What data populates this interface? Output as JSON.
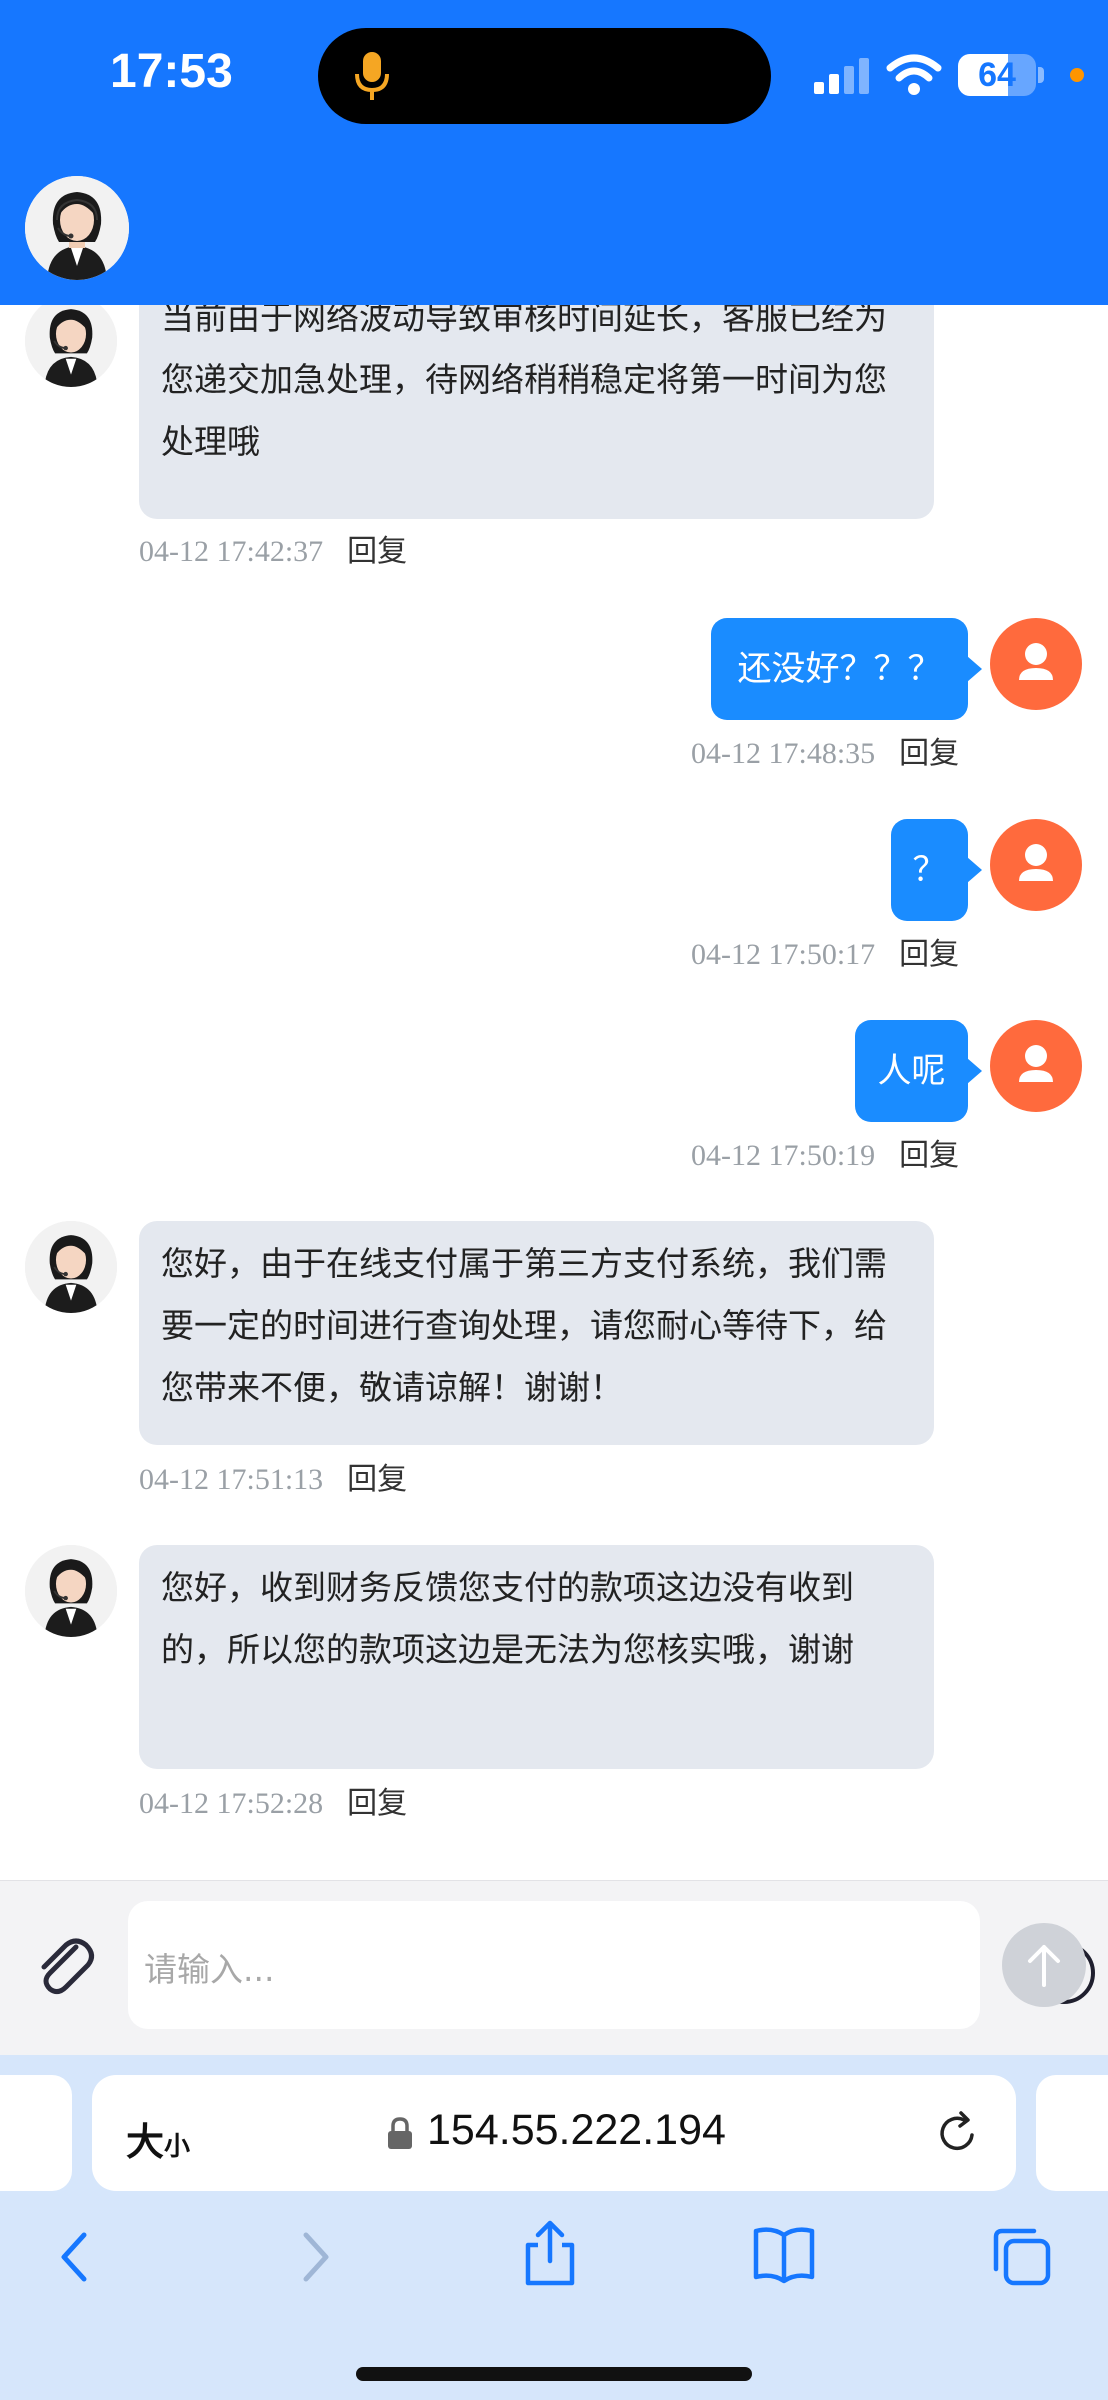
{
  "status_bar": {
    "time": "17:53",
    "battery": "64",
    "battery_level": 0.64
  },
  "messages": [
    {
      "side": "in",
      "text": "当前由于网络波动导致审核时间延长，客服已经为您递交加急处理，待网络稍稍稳定将第一时间为您处理哦",
      "timestamp": "04-12 17:42:37",
      "reply_label": "回复"
    },
    {
      "side": "out",
      "text": "还没好？？？",
      "timestamp": "04-12 17:48:35",
      "reply_label": "回复"
    },
    {
      "side": "out",
      "text": "？",
      "timestamp": "04-12 17:50:17",
      "reply_label": "回复"
    },
    {
      "side": "out",
      "text": "人呢",
      "timestamp": "04-12 17:50:19",
      "reply_label": "回复"
    },
    {
      "side": "in",
      "text": "您好，由于在线支付属于第三方支付系统，我们需要一定的时间进行查询处理，请您耐心等待下，给您带来不便，敬请谅解！谢谢！",
      "timestamp": "04-12 17:51:13",
      "reply_label": "回复"
    },
    {
      "side": "in",
      "text": "您好，收到财务反馈您支付的款项这边没有收到的，所以您的款项这边是无法为您核实哦，谢谢",
      "timestamp": "04-12 17:52:28",
      "reply_label": "回复"
    }
  ],
  "input": {
    "placeholder": "请输入..."
  },
  "browser": {
    "text_size_big": "大",
    "text_size_small": "小",
    "url": "154.55.222.194"
  },
  "colors": {
    "header": "#1677ff",
    "outgoing_bubble": "#1a8cff",
    "incoming_bubble": "#e4e8ef",
    "user_avatar": "#ff6a3d"
  }
}
